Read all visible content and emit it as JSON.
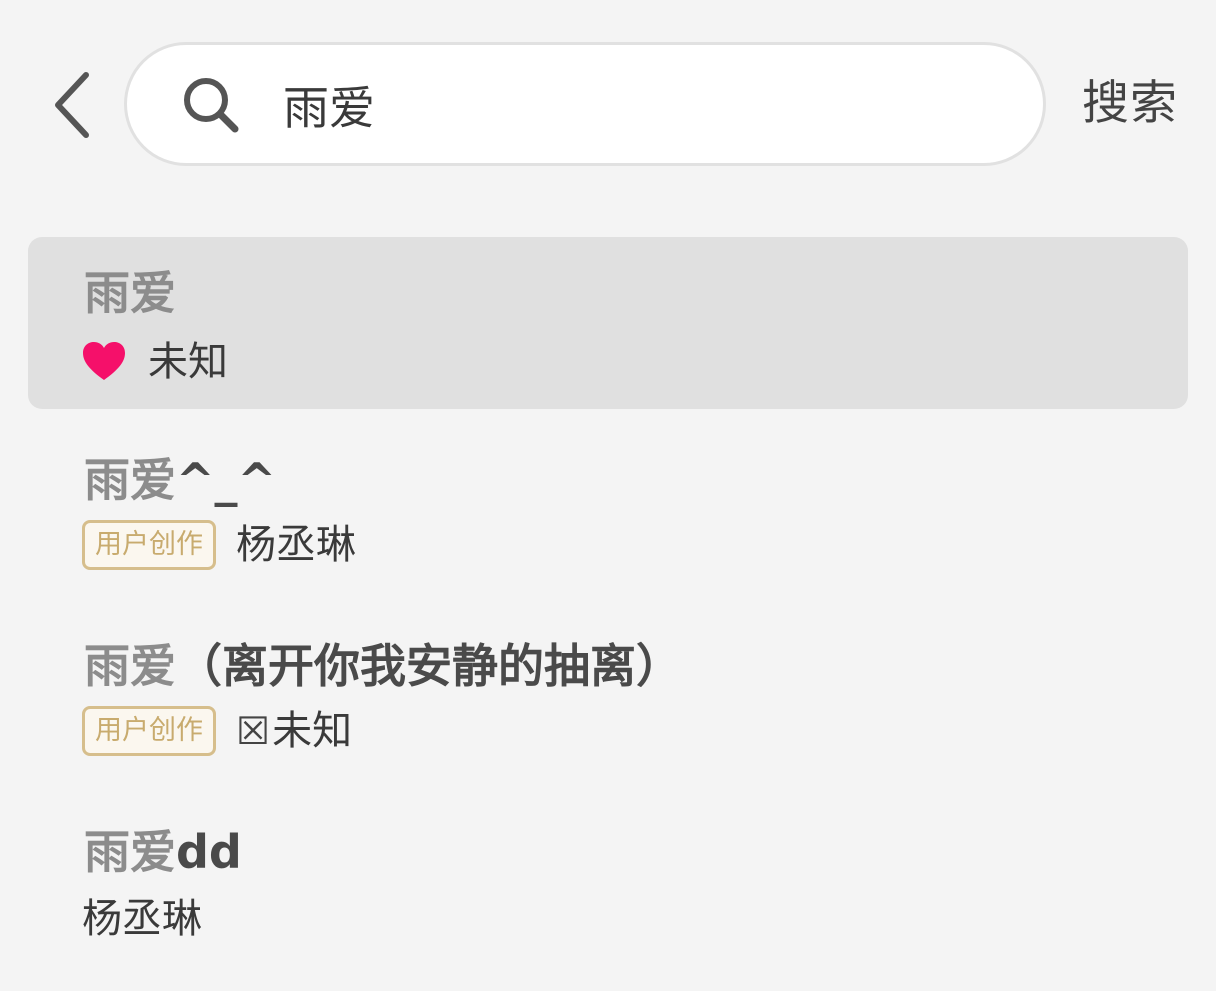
{
  "header": {
    "search_query": "雨爱",
    "search_button_label": "搜索"
  },
  "suggestions": [
    {
      "title_match": "雨爱",
      "title_rest": "",
      "subtitle": "未知",
      "icon": "heart-icon",
      "heart_color": "#f5106a",
      "highlighted": true
    },
    {
      "title_match": "雨爱",
      "title_rest": "^_^",
      "badge": "用户创作",
      "subtitle": "杨丞琳"
    },
    {
      "title_match": "雨爱",
      "title_rest": "（离开你我安静的抽离）",
      "badge": "用户创作",
      "subtitle_prefix": "☒",
      "subtitle": "未知"
    },
    {
      "title_match": "雨爱",
      "title_rest": "dd",
      "subtitle": "杨丞琳"
    }
  ],
  "colors": {
    "background": "#f4f4f4",
    "highlight_row": "#e0e0e0",
    "badge_border": "#d6be8c",
    "badge_text": "#c8ab6e"
  }
}
